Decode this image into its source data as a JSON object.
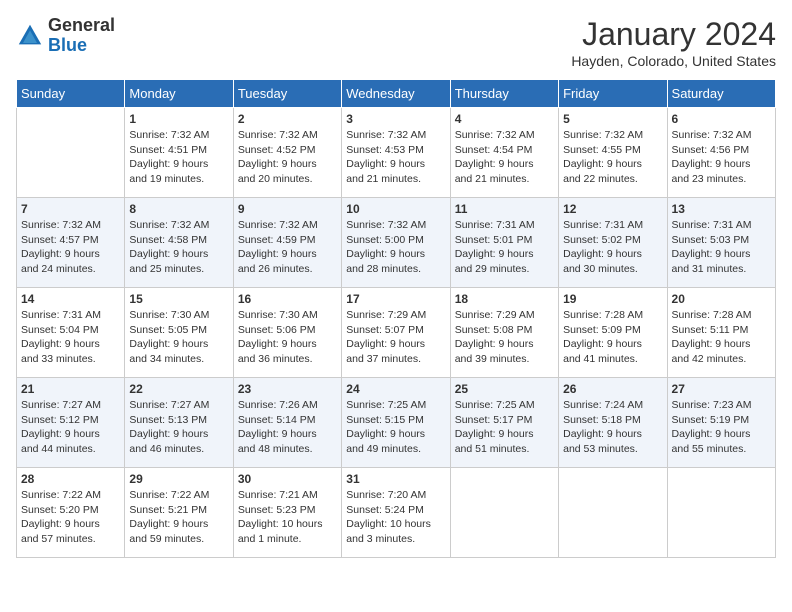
{
  "logo": {
    "text_general": "General",
    "text_blue": "Blue"
  },
  "title": "January 2024",
  "subtitle": "Hayden, Colorado, United States",
  "days_of_week": [
    "Sunday",
    "Monday",
    "Tuesday",
    "Wednesday",
    "Thursday",
    "Friday",
    "Saturday"
  ],
  "weeks": [
    [
      {
        "day": "",
        "info": ""
      },
      {
        "day": "1",
        "info": "Sunrise: 7:32 AM\nSunset: 4:51 PM\nDaylight: 9 hours\nand 19 minutes."
      },
      {
        "day": "2",
        "info": "Sunrise: 7:32 AM\nSunset: 4:52 PM\nDaylight: 9 hours\nand 20 minutes."
      },
      {
        "day": "3",
        "info": "Sunrise: 7:32 AM\nSunset: 4:53 PM\nDaylight: 9 hours\nand 21 minutes."
      },
      {
        "day": "4",
        "info": "Sunrise: 7:32 AM\nSunset: 4:54 PM\nDaylight: 9 hours\nand 21 minutes."
      },
      {
        "day": "5",
        "info": "Sunrise: 7:32 AM\nSunset: 4:55 PM\nDaylight: 9 hours\nand 22 minutes."
      },
      {
        "day": "6",
        "info": "Sunrise: 7:32 AM\nSunset: 4:56 PM\nDaylight: 9 hours\nand 23 minutes."
      }
    ],
    [
      {
        "day": "7",
        "info": "Sunrise: 7:32 AM\nSunset: 4:57 PM\nDaylight: 9 hours\nand 24 minutes."
      },
      {
        "day": "8",
        "info": "Sunrise: 7:32 AM\nSunset: 4:58 PM\nDaylight: 9 hours\nand 25 minutes."
      },
      {
        "day": "9",
        "info": "Sunrise: 7:32 AM\nSunset: 4:59 PM\nDaylight: 9 hours\nand 26 minutes."
      },
      {
        "day": "10",
        "info": "Sunrise: 7:32 AM\nSunset: 5:00 PM\nDaylight: 9 hours\nand 28 minutes."
      },
      {
        "day": "11",
        "info": "Sunrise: 7:31 AM\nSunset: 5:01 PM\nDaylight: 9 hours\nand 29 minutes."
      },
      {
        "day": "12",
        "info": "Sunrise: 7:31 AM\nSunset: 5:02 PM\nDaylight: 9 hours\nand 30 minutes."
      },
      {
        "day": "13",
        "info": "Sunrise: 7:31 AM\nSunset: 5:03 PM\nDaylight: 9 hours\nand 31 minutes."
      }
    ],
    [
      {
        "day": "14",
        "info": "Sunrise: 7:31 AM\nSunset: 5:04 PM\nDaylight: 9 hours\nand 33 minutes."
      },
      {
        "day": "15",
        "info": "Sunrise: 7:30 AM\nSunset: 5:05 PM\nDaylight: 9 hours\nand 34 minutes."
      },
      {
        "day": "16",
        "info": "Sunrise: 7:30 AM\nSunset: 5:06 PM\nDaylight: 9 hours\nand 36 minutes."
      },
      {
        "day": "17",
        "info": "Sunrise: 7:29 AM\nSunset: 5:07 PM\nDaylight: 9 hours\nand 37 minutes."
      },
      {
        "day": "18",
        "info": "Sunrise: 7:29 AM\nSunset: 5:08 PM\nDaylight: 9 hours\nand 39 minutes."
      },
      {
        "day": "19",
        "info": "Sunrise: 7:28 AM\nSunset: 5:09 PM\nDaylight: 9 hours\nand 41 minutes."
      },
      {
        "day": "20",
        "info": "Sunrise: 7:28 AM\nSunset: 5:11 PM\nDaylight: 9 hours\nand 42 minutes."
      }
    ],
    [
      {
        "day": "21",
        "info": "Sunrise: 7:27 AM\nSunset: 5:12 PM\nDaylight: 9 hours\nand 44 minutes."
      },
      {
        "day": "22",
        "info": "Sunrise: 7:27 AM\nSunset: 5:13 PM\nDaylight: 9 hours\nand 46 minutes."
      },
      {
        "day": "23",
        "info": "Sunrise: 7:26 AM\nSunset: 5:14 PM\nDaylight: 9 hours\nand 48 minutes."
      },
      {
        "day": "24",
        "info": "Sunrise: 7:25 AM\nSunset: 5:15 PM\nDaylight: 9 hours\nand 49 minutes."
      },
      {
        "day": "25",
        "info": "Sunrise: 7:25 AM\nSunset: 5:17 PM\nDaylight: 9 hours\nand 51 minutes."
      },
      {
        "day": "26",
        "info": "Sunrise: 7:24 AM\nSunset: 5:18 PM\nDaylight: 9 hours\nand 53 minutes."
      },
      {
        "day": "27",
        "info": "Sunrise: 7:23 AM\nSunset: 5:19 PM\nDaylight: 9 hours\nand 55 minutes."
      }
    ],
    [
      {
        "day": "28",
        "info": "Sunrise: 7:22 AM\nSunset: 5:20 PM\nDaylight: 9 hours\nand 57 minutes."
      },
      {
        "day": "29",
        "info": "Sunrise: 7:22 AM\nSunset: 5:21 PM\nDaylight: 9 hours\nand 59 minutes."
      },
      {
        "day": "30",
        "info": "Sunrise: 7:21 AM\nSunset: 5:23 PM\nDaylight: 10 hours\nand 1 minute."
      },
      {
        "day": "31",
        "info": "Sunrise: 7:20 AM\nSunset: 5:24 PM\nDaylight: 10 hours\nand 3 minutes."
      },
      {
        "day": "",
        "info": ""
      },
      {
        "day": "",
        "info": ""
      },
      {
        "day": "",
        "info": ""
      }
    ]
  ]
}
